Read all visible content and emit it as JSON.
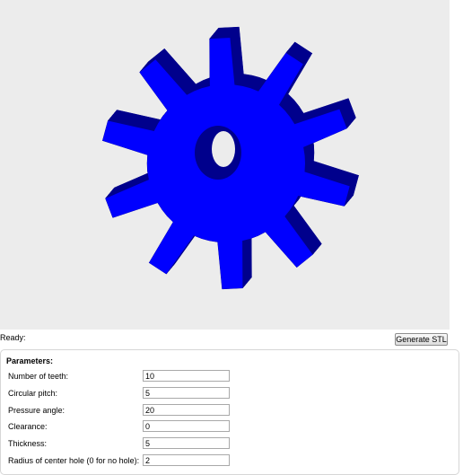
{
  "status": {
    "text": "Ready:"
  },
  "toolbar": {
    "generate_label": "Generate STL"
  },
  "parameters": {
    "title": "Parameters:",
    "rows": [
      {
        "label": "Number of teeth:",
        "value": "10"
      },
      {
        "label": "Circular pitch:",
        "value": "5"
      },
      {
        "label": "Pressure angle:",
        "value": "20"
      },
      {
        "label": "Clearance:",
        "value": "0"
      },
      {
        "label": "Thickness:",
        "value": "5"
      },
      {
        "label": "Radius of center hole (0 for no hole):",
        "value": "2"
      }
    ]
  },
  "colors": {
    "viewer_bg": "#ececec",
    "gear_face": "#0000ff",
    "gear_side": "#00008c"
  }
}
